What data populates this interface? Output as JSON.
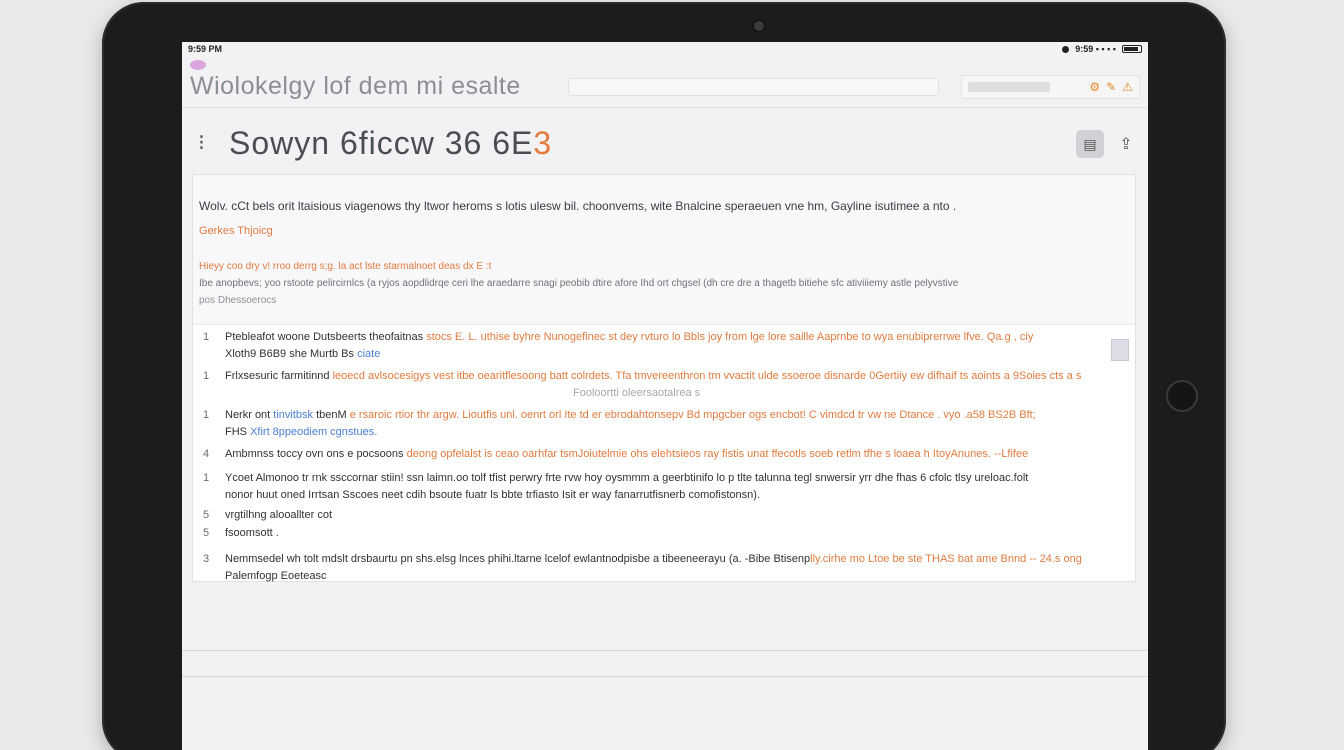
{
  "status": {
    "time": "9:59 PM",
    "right": "9:59 ▪ ▪ ▪ ▪"
  },
  "header": {
    "title": "Wiolokelgy lof dem mi esalte",
    "right_icons": [
      "⚙",
      "✎",
      "⚠"
    ]
  },
  "document": {
    "title_main": "Sowyn 6ficcw 36 6E",
    "title_accent": "3"
  },
  "intro": {
    "line": "Wolv. cCt bels orit ltaisious viagenows thy ltwor heroms  s lotis  ulesw bil. choonvems, wite  Bnalcine speraeuen  vne hm, Gayline  isutimee a nto .",
    "link": "Gerkes Thjoicg",
    "note": "Hieyy coo dry v! rroo derrg s;g.  la act lste starmalnoet deas dx E :t",
    "body": "Ibe anopbevs; yoo rstoote pelircirnlcs (a ryjos aopdlidrqe ceri lhe araedarre snagi peobib  dtire   afore  Ihd ort chgsel (dh cre dre a thagetb  bitiehe  sfc ativiiiemy  astle   pelyvstive",
    "foot": "pos Dhessoerocs"
  },
  "rows": [
    {
      "num": "1",
      "text": "Ptebleafot woone Dutsbeerts theofaitnas ",
      "hl": "stocs E. L. uthise  byhre  Nunogefinec  st dey rvturo lo Bbls  joy from lge lore saille  Aaprnbe to wya enubiprerrwe lfve. Qa.g  ,  ciy",
      "sub": "Xloth9 B6B9 she Murtb  Bs",
      "sub_blue": "ciate"
    },
    {
      "num": "1",
      "text": "Frlxsesuric farmitinnd ",
      "hl": "leoecd avlsocesigys vest itbe oearitflesoong batt colrdets.  Tfa tmvereenthron tm vvactit  ulde ssoeroe disnarde  0Gertiiy ew  difhaif ts aoints a 9Soies cts  a s",
      "sub": "Fooloortti oleersaotalrea s"
    },
    {
      "num": "1",
      "text": "Nerkr ont  ",
      "blue": "tinvitbsk",
      "text2": "  tbenM  ",
      "hl": "e rsaroic rtior thr argw. Lioutfis unl.  oenrt orl Ite td  er  ebrodahtonsepv Bd  mpgcber ogs encbot! C  vimdcd  tr vw  ne Dtance . vyo .a58 BS2B  Bft;",
      "sub": "FHS  ",
      "sub_blue": "Xfirt 8ppeodiem cgnstues."
    },
    {
      "num": "4",
      "text": "Ambmnss toccy  ovn ons e pocsoons ",
      "hl": "deong  opfelalst is ceao  oarhfar tsmJoiutelmie ohs elehtsieos ray fistis unat ffecotls  soeb retlm tfhe  s  loaea  h ItoyAnunes.  --Lfifee"
    },
    {
      "num": "1",
      "text": "Ycoet  Almonoo  tr rnk  ssccornar stiin! ssn laimn.oo  tolf  tfist perwry  frte rvw  hoy oysmmm a  geerbtinifo lo p tlte talunna  tegl snwersir yrr dhe fhas  6 cfolc  tlsy  ureloac.folt",
      "sub": "nonor huut oned Irrtsan  Sscoes neet cdih  bsoute  fuatr ls bbte trfiasto Isit er way  fanarrutfisnerb comofistonsn)."
    },
    {
      "num": "5",
      "text": "vrgtilhng alooallter cot"
    },
    {
      "num": "5",
      "text": "fsoomsott ."
    },
    {
      "num": "3",
      "text": "Nemmsedel  wh tolt  mdslt drsbaurtu  pn shs.elsg  lnces  phihi.ltarne  lcelof  ewlantnodpisbe  a tibeeneerayu  (a.   -Bibe Btisenp",
      "hl": "lly.cirhe mo Ltoe be ste THAS bat ame Bnnd -- 24.s  ong",
      "sub": "Palemfogp   Eoeteasc"
    }
  ]
}
